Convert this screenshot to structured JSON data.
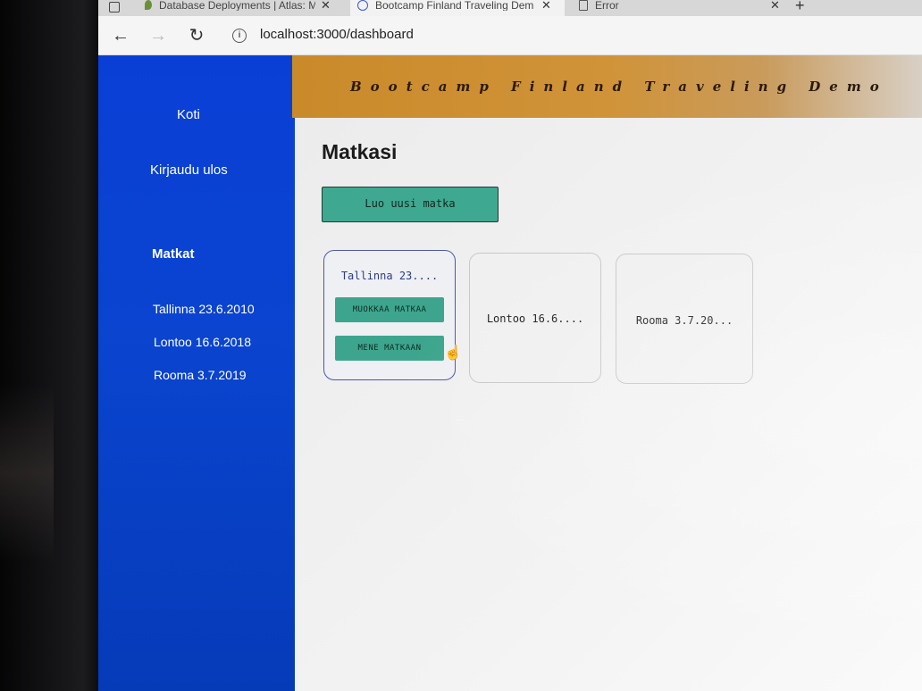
{
  "browser": {
    "tabs": [
      {
        "label": "Database Deployments | Atlas: M",
        "active": false
      },
      {
        "label": "Bootcamp Finland Traveling Dem",
        "active": true
      },
      {
        "label": "Error",
        "active": false
      }
    ],
    "tab_close": "✕",
    "new_tab": "+",
    "back": "←",
    "forward": "→",
    "reload": "↻",
    "info": "i",
    "url": "localhost:3000/dashboard"
  },
  "sidebar": {
    "home": "Koti",
    "logout": "Kirjaudu ulos",
    "trips_heading": "Matkat",
    "trips": [
      {
        "label": "Tallinna 23.6.2010"
      },
      {
        "label": "Lontoo 16.6.2018"
      },
      {
        "label": "Rooma 3.7.2019"
      }
    ]
  },
  "header": {
    "title": "Bootcamp Finland Traveling Demo"
  },
  "main": {
    "title": "Matkasi",
    "new_trip_button": "Luo uusi matka",
    "cards": [
      {
        "title": "Tallinna 23....",
        "edit_label": "MUOKKAA MATKAA",
        "go_label": "MENE MATKAAN",
        "active": true
      },
      {
        "title": "Lontoo 16.6....",
        "active": false
      },
      {
        "title": "Rooma 3.7.20...",
        "active": false
      }
    ]
  },
  "colors": {
    "sidebar_blue": "#0a3fd6",
    "header_orange": "#c98a2a",
    "button_teal": "#3fa890",
    "active_card_border": "#4b59a8"
  }
}
